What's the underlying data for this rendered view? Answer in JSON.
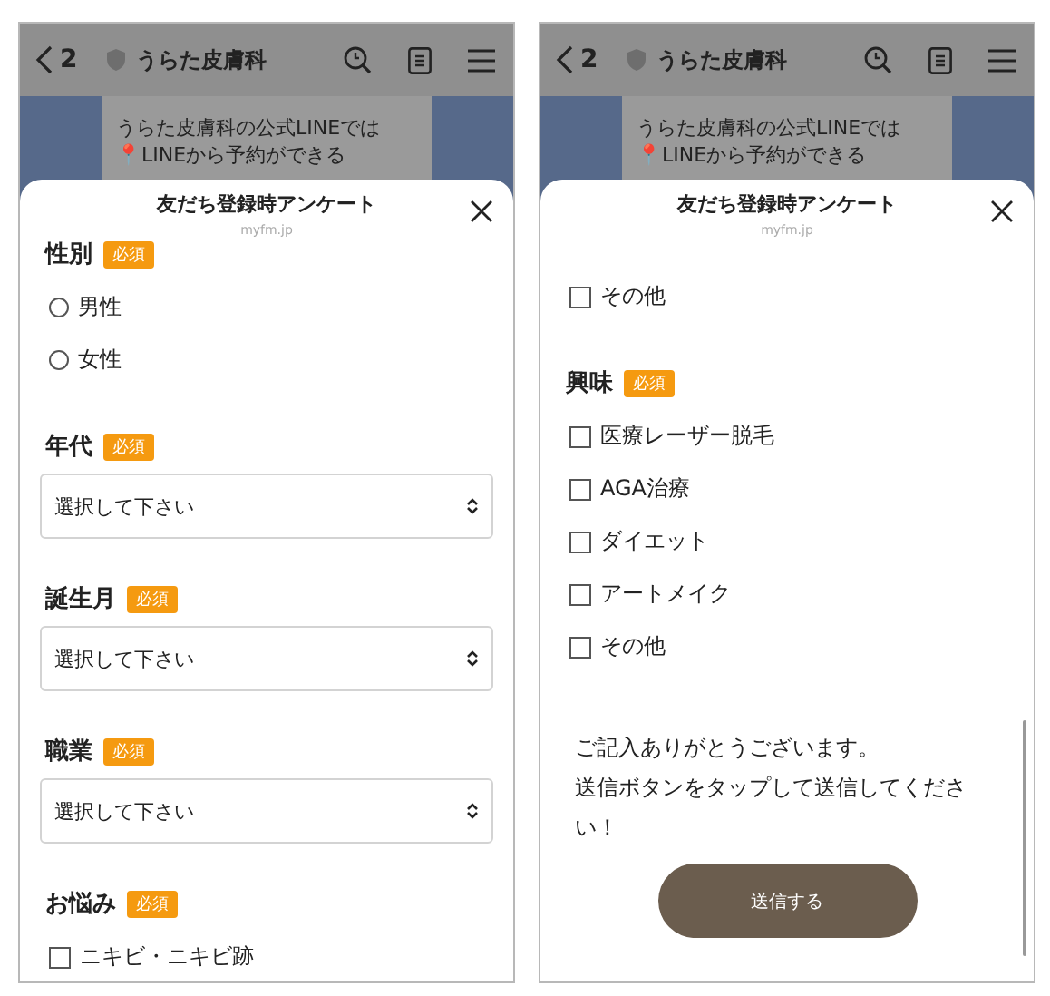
{
  "phones": [
    {
      "header": {
        "back": "2",
        "title": "うらた皮膚科"
      },
      "message": [
        "うらた皮膚科の公式LINEでは",
        "📍LINEから予約ができる"
      ],
      "sheet": {
        "title": "友だち登録時アンケート",
        "domain": "myfm.jp",
        "scrolled": false
      },
      "items": [
        {
          "kind": "question",
          "label": "性別",
          "badge": "必須"
        },
        {
          "kind": "radio",
          "label": "男性",
          "selected": false
        },
        {
          "kind": "radio",
          "label": "女性",
          "selected": false
        },
        {
          "kind": "question",
          "label": "年代",
          "badge": "必須"
        },
        {
          "kind": "select",
          "value": "選択して下さい"
        },
        {
          "kind": "question",
          "label": "誕生月",
          "badge": "必須"
        },
        {
          "kind": "select",
          "value": "選択して下さい"
        },
        {
          "kind": "question",
          "label": "職業",
          "badge": "必須"
        },
        {
          "kind": "select",
          "value": "選択して下さい"
        },
        {
          "kind": "question",
          "label": "お悩み",
          "badge": "必須"
        },
        {
          "kind": "checkbox",
          "label": "ニキビ・ニキビ跡",
          "checked": false
        }
      ]
    },
    {
      "header": {
        "back": "2",
        "title": "うらた皮膚科"
      },
      "message": [
        "うらた皮膚科の公式LINEでは",
        "📍LINEから予約ができる"
      ],
      "sheet": {
        "title": "友だち登録時アンケート",
        "domain": "myfm.jp",
        "scrolled": true
      },
      "items": [
        {
          "kind": "checkbox",
          "label": "その他",
          "checked": false
        },
        {
          "kind": "question",
          "label": "興味",
          "badge": "必須"
        },
        {
          "kind": "checkbox",
          "label": "医療レーザー脱毛",
          "checked": false
        },
        {
          "kind": "checkbox",
          "label": "AGA治療",
          "checked": false
        },
        {
          "kind": "checkbox",
          "label": "ダイエット",
          "checked": false
        },
        {
          "kind": "checkbox",
          "label": "アートメイク",
          "checked": false
        },
        {
          "kind": "checkbox",
          "label": "その他",
          "checked": false
        },
        {
          "kind": "note",
          "lines": [
            "ご記入ありがとうございます。",
            "送信ボタンをタップして送信してください！"
          ]
        },
        {
          "kind": "button",
          "label": "送信する"
        }
      ]
    }
  ]
}
